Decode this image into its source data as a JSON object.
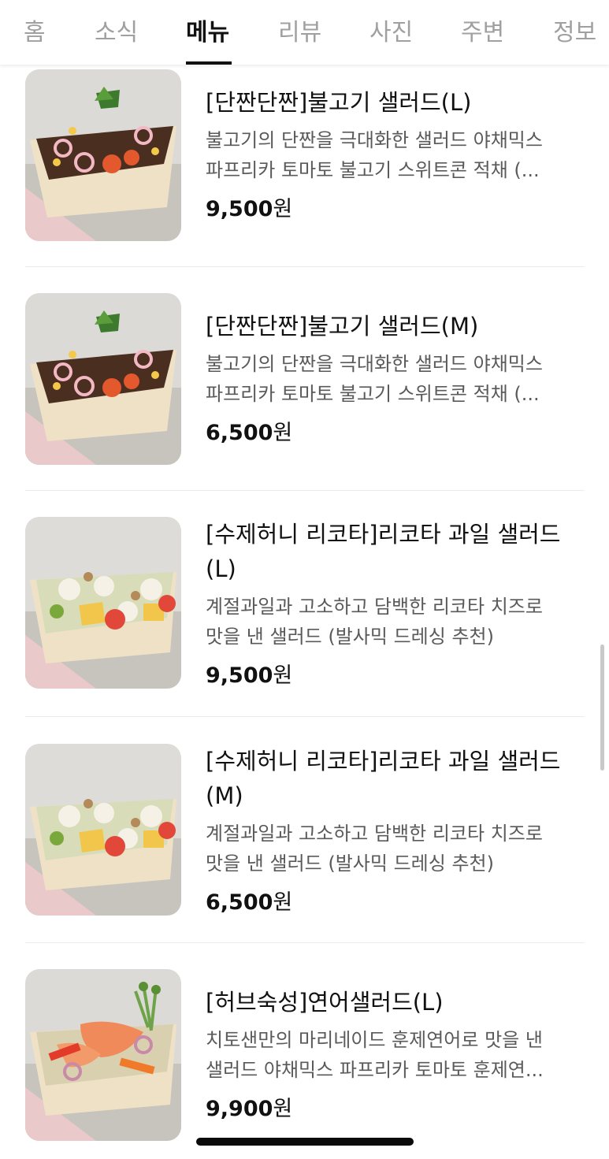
{
  "tabs": {
    "home": "홈",
    "news": "소식",
    "menu": "메뉴",
    "review": "리뷰",
    "photo": "사진",
    "nearby": "주변",
    "info": "정보"
  },
  "items": [
    {
      "name": "[단짠단짠]불고기 샐러드(L)",
      "desc1": "불고기의 단짠을 극대화한 샐러드 야채믹스",
      "desc2": "파프리카 토마토 불고기 스위트콘 적채 (...",
      "price_num": "9,500",
      "price_unit": "원"
    },
    {
      "name": "[단짠단짠]불고기 샐러드(M)",
      "desc1": "불고기의 단짠을 극대화한 샐러드 야채믹스",
      "desc2": "파프리카 토마토 불고기 스위트콘 적채 (...",
      "price_num": "6,500",
      "price_unit": "원"
    },
    {
      "name1": "[수제허니 리코타]리코타 과일 샐러드",
      "name2": "(L)",
      "desc1": "계절과일과 고소하고 담백한 리코타 치즈로",
      "desc2": "맛을 낸 샐러드 (발사믹 드레싱 추천)",
      "price_num": "9,500",
      "price_unit": "원"
    },
    {
      "name1": "[수제허니 리코타]리코타 과일 샐러드",
      "name2": "(M)",
      "desc1": "계절과일과 고소하고 담백한 리코타 치즈로",
      "desc2": "맛을 낸 샐러드 (발사믹 드레싱 추천)",
      "price_num": "6,500",
      "price_unit": "원"
    },
    {
      "name": "[허브숙성]연어샐러드(L)",
      "desc1": "치토샌만의 마리네이드 훈제연어로 맛을 낸",
      "desc2": "샐러드 야채믹스 파프리카 토마토 훈제연...",
      "price_num": "9,900",
      "price_unit": "원"
    }
  ]
}
